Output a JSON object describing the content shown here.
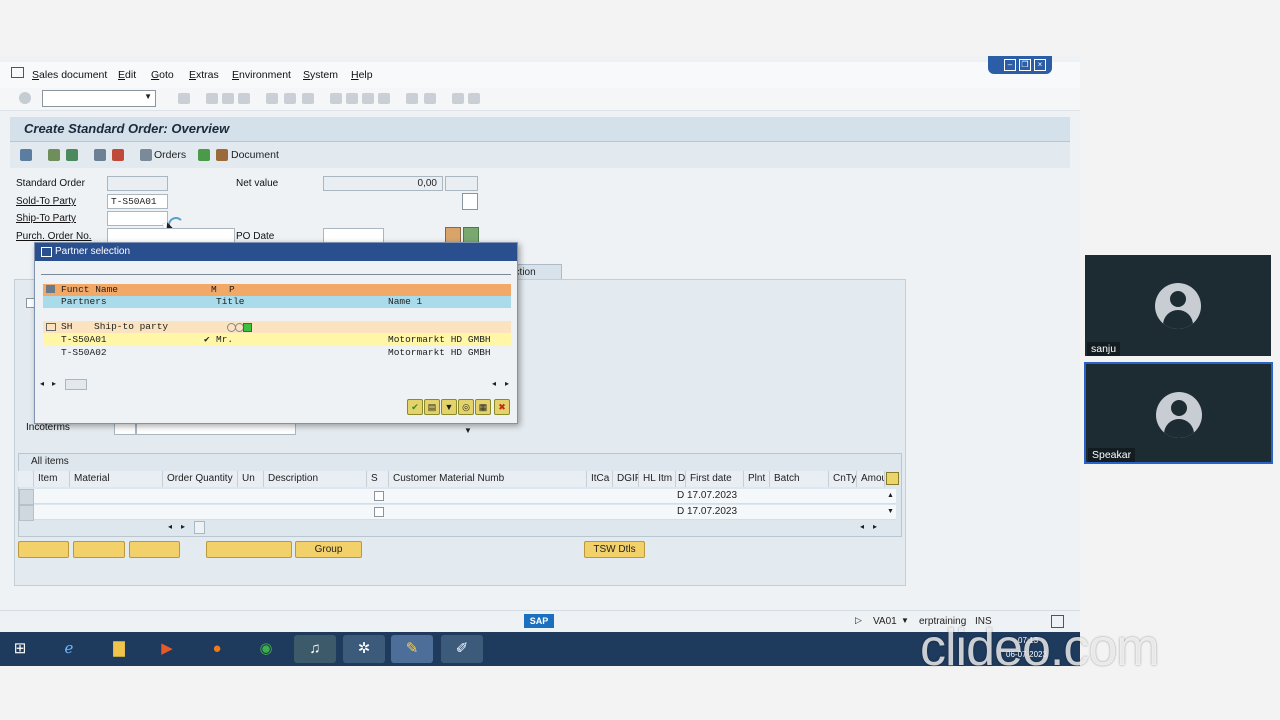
{
  "menu": {
    "items": [
      "Sales document",
      "Edit",
      "Goto",
      "Extras",
      "Environment",
      "System",
      "Help"
    ]
  },
  "title": "Create Standard Order: Overview",
  "app_toolbar": {
    "orders": "Orders",
    "document": "Document"
  },
  "header": {
    "standard_order_label": "Standard Order",
    "net_value_label": "Net value",
    "net_value": "0,00",
    "sold_to_label": "Sold-To Party",
    "sold_to_value": "T-S50A01",
    "ship_to_label": "Ship-To Party",
    "po_label": "Purch. Order No.",
    "po_date_label": "PO Date"
  },
  "tab_partial": "ection",
  "incoterms_label": "Incoterms",
  "popup": {
    "title": "Partner selection",
    "header_row1": {
      "funct_name": "Funct Name",
      "m": "M",
      "p": "P"
    },
    "header_row2": {
      "partners": "Partners",
      "title": "Title",
      "name1": "Name 1"
    },
    "group": {
      "code": "SH",
      "name": "Ship-to party"
    },
    "rows": [
      {
        "partner": "T-S50A01",
        "check": "✔",
        "title": "Mr.",
        "name1": "Motormarkt HD GMBH"
      },
      {
        "partner": "T-S50A02",
        "check": "",
        "title": "",
        "name1": "Motormarkt HD GMBH"
      }
    ]
  },
  "items": {
    "header": "All items",
    "columns": [
      "Item",
      "Material",
      "Order Quantity",
      "Un",
      "Description",
      "S",
      "Customer Material Numb",
      "ItCa",
      "DGIP",
      "HL Itm",
      "D",
      "First date",
      "Plnt",
      "Batch",
      "CnTy",
      "Amou"
    ],
    "rows": [
      {
        "d": "D",
        "first_date": "17.07.2023"
      },
      {
        "d": "D",
        "first_date": "17.07.2023"
      }
    ],
    "group_button": "Group",
    "tsw_button": "TSW Dtls"
  },
  "status": {
    "tcode": "VA01",
    "server": "erptraining",
    "mode": "INS",
    "sap_logo": "SAP"
  },
  "clock": {
    "time": "07:13",
    "date": "06-07-2023"
  },
  "participants": [
    {
      "name": "sanju"
    },
    {
      "name": "Speakar"
    }
  ],
  "watermark": "clideo.com"
}
